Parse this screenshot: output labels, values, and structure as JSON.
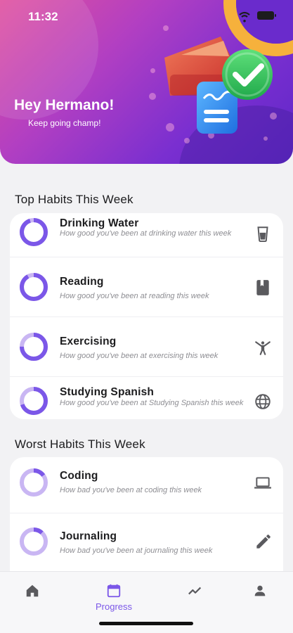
{
  "status_bar": {
    "time": "11:32"
  },
  "header": {
    "greeting": "Hey Hermano!",
    "subtitle": "Keep going champ!"
  },
  "top_section": {
    "title": "Top Habits This Week",
    "items": [
      {
        "title": "Drinking Water",
        "description": "How good you've been at drinking water this week",
        "icon": "cup-icon",
        "progress": 0.95
      },
      {
        "title": "Reading",
        "description": "How good you've been at reading  this week",
        "icon": "book-icon",
        "progress": 0.92
      },
      {
        "title": "Exercising",
        "description": "How good you've been at exercising this week",
        "icon": "gymnastics-icon",
        "progress": 0.75
      },
      {
        "title": "Studying Spanish",
        "description": "How good you've been at Studying Spanish this week",
        "icon": "globe-icon",
        "progress": 0.7
      }
    ]
  },
  "worst_section": {
    "title": "Worst Habits This Week",
    "items": [
      {
        "title": "Coding",
        "description": "How bad you've been at coding this week",
        "icon": "laptop-icon",
        "progress": 0.15
      },
      {
        "title": "Journaling",
        "description": "How bad you've been at journaling this week",
        "icon": "pencil-icon",
        "progress": 0.12
      }
    ]
  },
  "tabbar": {
    "tabs": [
      {
        "name": "home",
        "icon": "home-icon"
      },
      {
        "name": "progress",
        "label": "Progress",
        "icon": "calendar-icon",
        "active": true
      },
      {
        "name": "stats",
        "icon": "trending-icon"
      },
      {
        "name": "profile",
        "icon": "person-icon"
      }
    ]
  },
  "colors": {
    "accent": "#7b57e8",
    "ring_fill": "#7b57e8",
    "ring_track": "#c9b6f3",
    "gold": "#f6b13c"
  }
}
